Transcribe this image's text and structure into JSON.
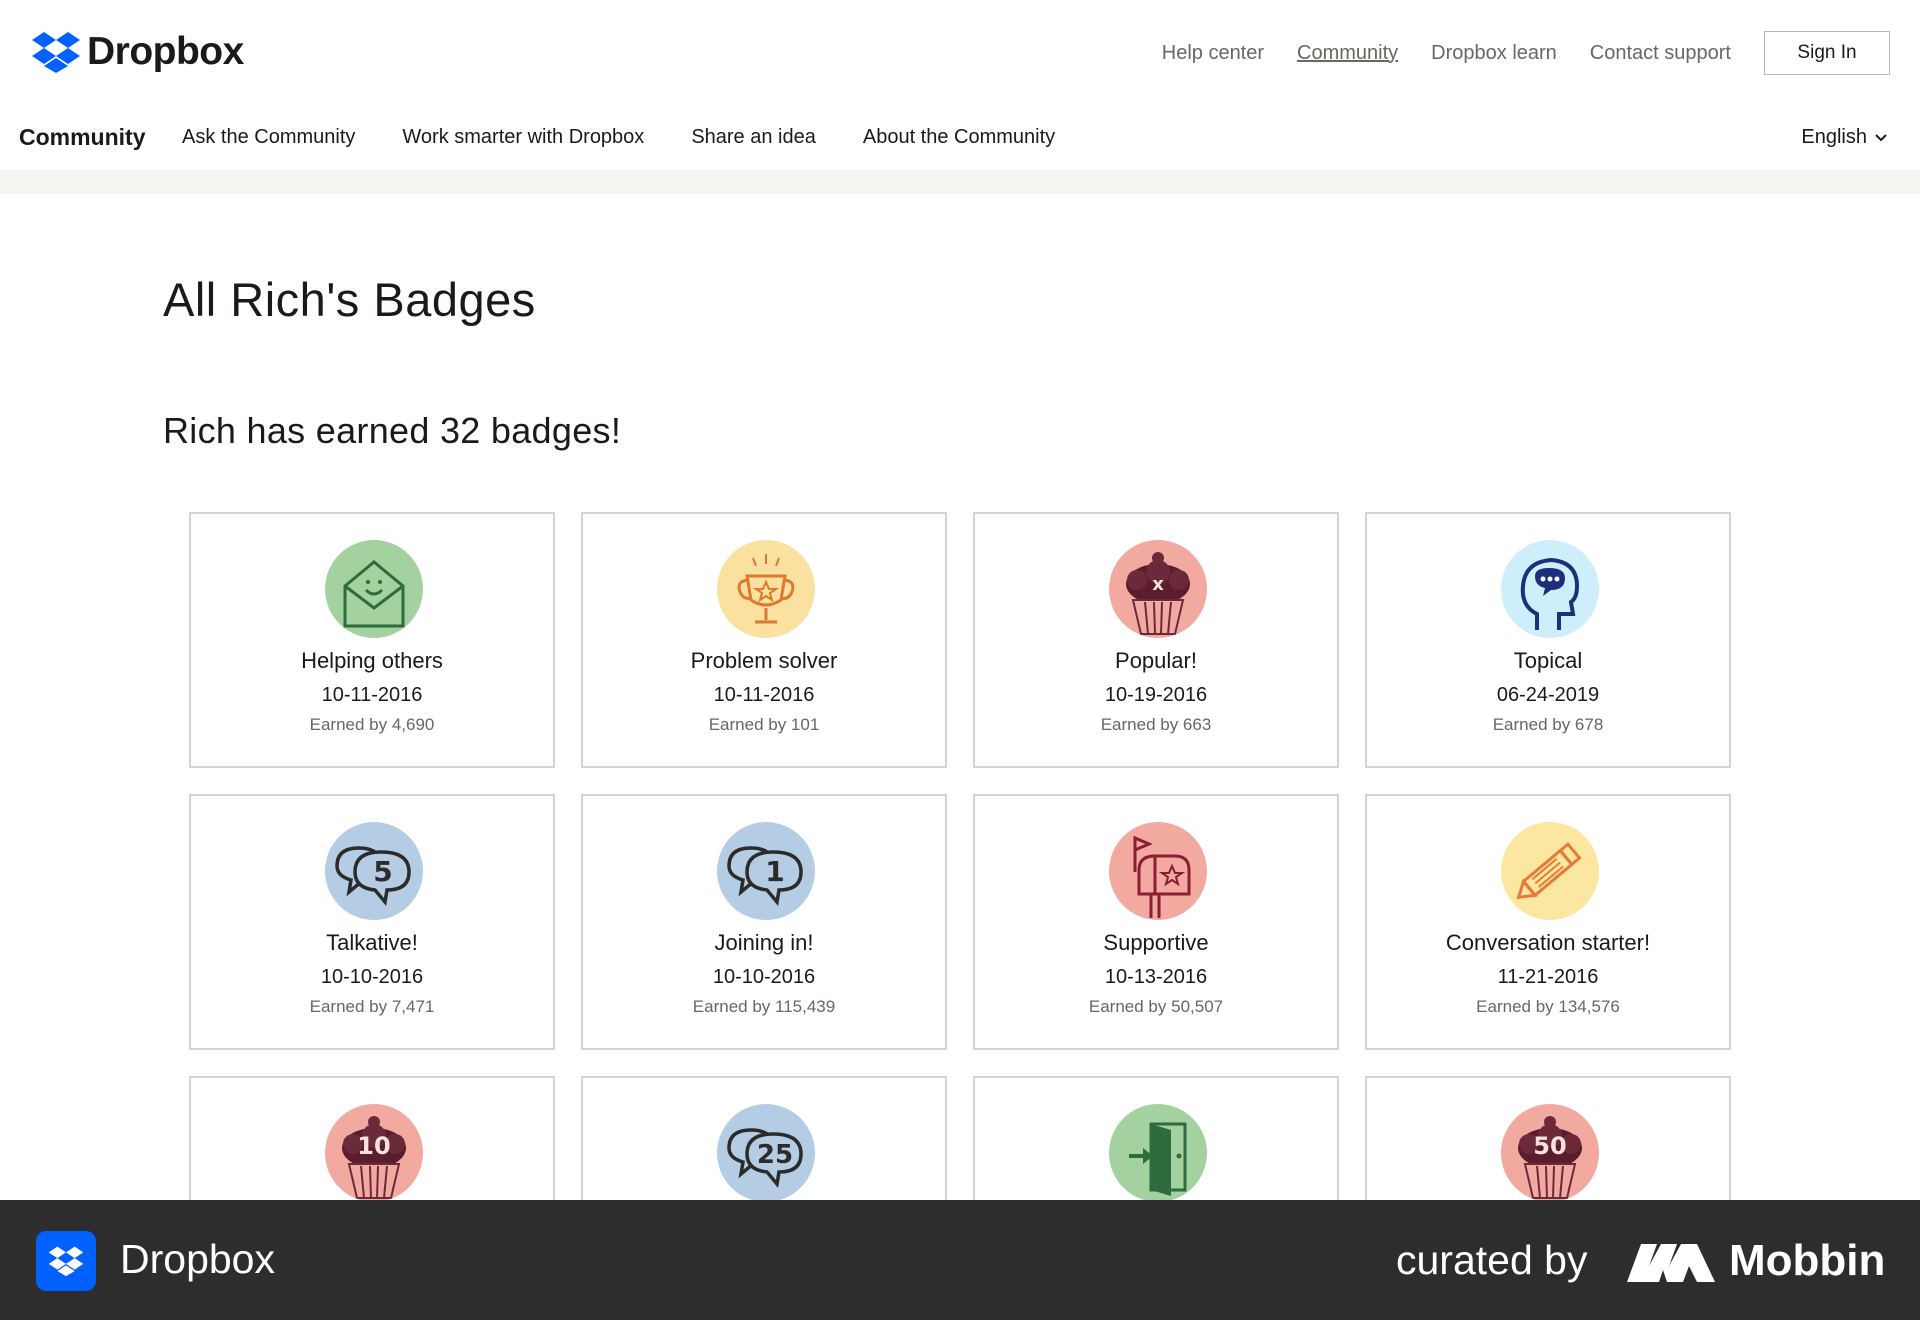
{
  "header": {
    "brand": "Dropbox",
    "links": [
      {
        "label": "Help center",
        "underlined": false
      },
      {
        "label": "Community",
        "underlined": true
      },
      {
        "label": "Dropbox learn",
        "underlined": false
      },
      {
        "label": "Contact support",
        "underlined": false
      }
    ],
    "sign_in_label": "Sign In"
  },
  "nav": {
    "title": "Community",
    "items": [
      "Ask the Community",
      "Work smarter with Dropbox",
      "Share an idea",
      "About the Community"
    ],
    "language": "English"
  },
  "page": {
    "title": "All Rich's Badges",
    "subtitle": "Rich has earned 32 badges!"
  },
  "badges": [
    {
      "name": "Helping others",
      "date": "10-11-2016",
      "earned": "Earned by 4,690",
      "icon": "envelope-smile-icon",
      "bg": "#a4d1a0"
    },
    {
      "name": "Problem solver",
      "date": "10-11-2016",
      "earned": "Earned by 101",
      "icon": "trophy-icon",
      "bg": "#fbe1a0"
    },
    {
      "name": "Popular!",
      "date": "10-19-2016",
      "earned": "Earned by 663",
      "icon": "cupcake-icon",
      "bg": "#f2a9a0"
    },
    {
      "name": "Topical",
      "date": "06-24-2019",
      "earned": "Earned by 678",
      "icon": "head-chat-icon",
      "bg": "#cdeefa"
    },
    {
      "name": "Talkative!",
      "date": "10-10-2016",
      "earned": "Earned by 7,471",
      "icon": "speech-bubbles-5-icon",
      "bg": "#b4cde5",
      "number": "5"
    },
    {
      "name": "Joining in!",
      "date": "10-10-2016",
      "earned": "Earned by 115,439",
      "icon": "speech-bubbles-1-icon",
      "bg": "#b4cde5",
      "number": "1"
    },
    {
      "name": "Supportive",
      "date": "10-13-2016",
      "earned": "Earned by 50,507",
      "icon": "mailbox-icon",
      "bg": "#f2a9a0"
    },
    {
      "name": "Conversation starter!",
      "date": "11-21-2016",
      "earned": "Earned by 134,576",
      "icon": "pencil-icon",
      "bg": "#fbe7a0"
    },
    {
      "name": "",
      "date": "",
      "earned": "",
      "icon": "cupcake-10-icon",
      "bg": "#f2a9a0",
      "number": "10"
    },
    {
      "name": "",
      "date": "",
      "earned": "",
      "icon": "speech-bubbles-25-icon",
      "bg": "#b4cde5",
      "number": "25"
    },
    {
      "name": "",
      "date": "",
      "earned": "",
      "icon": "door-icon",
      "bg": "#a4d1a0"
    },
    {
      "name": "",
      "date": "",
      "earned": "",
      "icon": "cupcake-50-icon",
      "bg": "#f2a9a0",
      "number": "50"
    }
  ],
  "footer": {
    "brand": "Dropbox",
    "curated": "curated by",
    "mobbin": "Mobbin"
  },
  "colors": {
    "brand_blue": "#0061fe",
    "band": "#f7f5f2",
    "footer_bg": "#2d2d2d"
  }
}
